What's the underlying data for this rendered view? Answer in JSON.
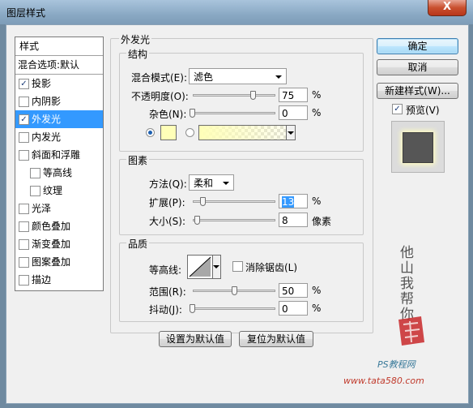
{
  "window": {
    "title": "图层样式",
    "close_glyph": "X"
  },
  "styles_list": {
    "header": "样式",
    "blend_options": "混合选项:默认",
    "items": [
      {
        "label": "投影",
        "checked": true
      },
      {
        "label": "内阴影",
        "checked": false
      },
      {
        "label": "外发光",
        "checked": true,
        "selected": true
      },
      {
        "label": "内发光",
        "checked": false
      },
      {
        "label": "斜面和浮雕",
        "checked": false
      },
      {
        "label": "等高线",
        "checked": false
      },
      {
        "label": "纹理",
        "checked": false
      },
      {
        "label": "光泽",
        "checked": false
      },
      {
        "label": "颜色叠加",
        "checked": false
      },
      {
        "label": "渐变叠加",
        "checked": false
      },
      {
        "label": "图案叠加",
        "checked": false
      },
      {
        "label": "描边",
        "checked": false
      }
    ]
  },
  "panel": {
    "title": "外发光",
    "structure": {
      "title": "结构",
      "blend_mode_label": "混合模式(E):",
      "blend_mode_value": "滤色",
      "opacity_label": "不透明度(O):",
      "opacity_value": "75",
      "noise_label": "杂色(N):",
      "noise_value": "0",
      "percent": "%",
      "glow_color": "#ffffb8"
    },
    "elements": {
      "title": "图素",
      "method_label": "方法(Q):",
      "method_value": "柔和",
      "spread_label": "扩展(P):",
      "spread_value": "13",
      "size_label": "大小(S):",
      "size_value": "8",
      "size_unit": "像素",
      "percent": "%"
    },
    "quality": {
      "title": "品质",
      "contour_label": "等高线:",
      "antialias_label": "消除锯齿(L)",
      "range_label": "范围(R):",
      "range_value": "50",
      "jitter_label": "抖动(J):",
      "jitter_value": "0",
      "percent": "%"
    },
    "set_default_label": "设置为默认值",
    "reset_default_label": "复位为默认值"
  },
  "actions": {
    "ok_label": "确定",
    "cancel_label": "取消",
    "new_style_label": "新建样式(W)...",
    "preview_label": "预览(V)",
    "preview_checked": true
  },
  "watermark": {
    "site_name": "PS教程网",
    "url": "www.tata580.com",
    "handwriting": "他山我帮你"
  },
  "colors": {
    "selection": "#3399ff",
    "glow": "#ffffb8",
    "stamp": "#c8282a",
    "preview_square": "#565656"
  }
}
